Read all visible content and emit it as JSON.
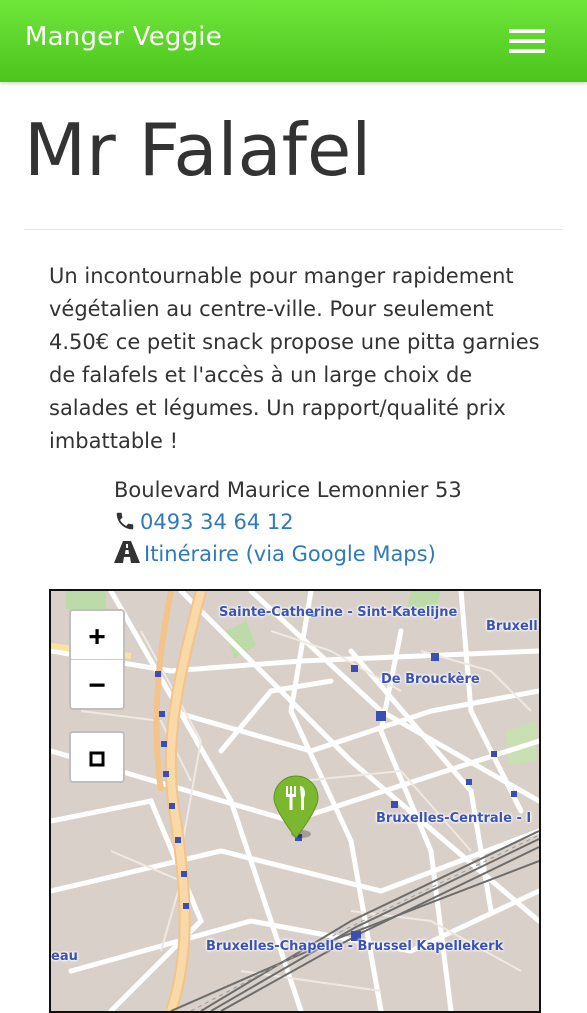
{
  "navbar": {
    "brand": "Manger Veggie",
    "menu_icon": "hamburger-menu-icon",
    "color": "#5ad62a"
  },
  "restaurant": {
    "name": "Mr Falafel",
    "description": "Un incontournable pour manger rapidement végétalien au centre-ville. Pour seulement 4.50€ ce petit snack propose une pitta garnies de falafels et l'accès à un large choix de salades et légumes. Un rapport/qualité prix imbattable !",
    "address": "Boulevard Maurice Lemonnier 53",
    "phone": "0493 34 64 12",
    "directions_link": "Itinéraire (via Google Maps)",
    "phone_icon": "phone-icon",
    "directions_icon": "road-icon",
    "link_color": "#2f7ab9"
  },
  "map": {
    "controls": {
      "zoom_in": "+",
      "zoom_out": "−",
      "fullscreen_icon": "fullscreen-icon"
    },
    "labels": {
      "sainte_catherine": "Sainte-Catherine - Sint-Katelijne",
      "bruxelles_top": "Bruxell",
      "de_brouckere": "De Brouckère",
      "bruxelles_centrale": "Bruxelles-Centrale - I",
      "bruxelles_chapelle": "Bruxelles-Chapelle - Brussel Kapellekerk",
      "left_edge": "eau"
    },
    "marker_icon": "restaurant-marker-icon",
    "marker_color": "#7cb82f"
  }
}
